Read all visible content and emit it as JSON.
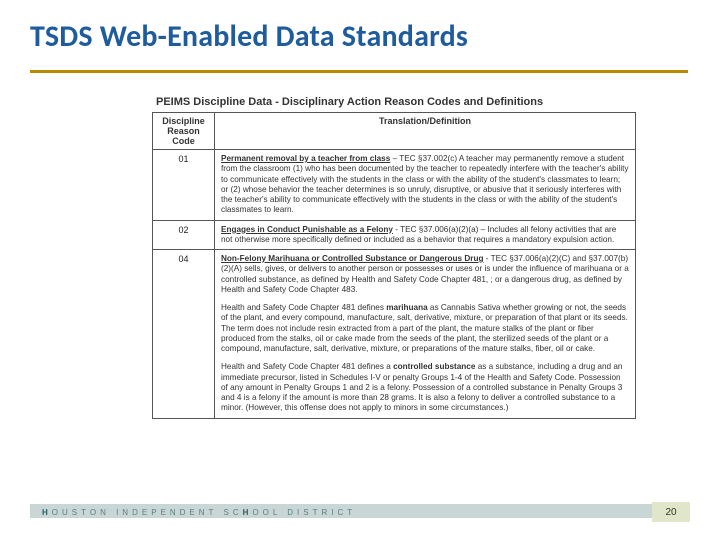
{
  "title": "TSDS Web-Enabled Data Standards",
  "panel_title": "PEIMS Discipline Data - Disciplinary Action Reason Codes and Definitions",
  "header_code": "Discipline Reason Code",
  "header_def": "Translation/Definition",
  "footer_letters": "HOUSTON INDEPENDENT SCHOOL DISTRICT",
  "page_number": "20",
  "rows": [
    {
      "code": "01",
      "lead": "Permanent removal by a teacher from class",
      "body": " – TEC §37.002(c) A teacher may permanently remove a student from the classroom (1) who has been documented by the teacher to repeatedly interfere with the teacher's ability to communicate effectively with the students in the class or with the ability of the student's classmates to learn; or (2) whose behavior the teacher determines is so unruly, disruptive, or abusive that it seriously interferes with the teacher's ability to communicate effectively with the students in the class or with the ability of the student's classmates to learn."
    },
    {
      "code": "02",
      "lead": "Engages in Conduct Punishable as a Felony",
      "body": " - TEC §37.006(a)(2)(a) – Includes all felony activities that are not otherwise more specifically defined or included as a behavior that requires a mandatory expulsion action."
    },
    {
      "code": "04",
      "lead": "Non-Felony Marihuana or Controlled Substance or Dangerous Drug",
      "body": " - TEC §37.006(a)(2)(C) and §37.007(b)(2)(A) sells, gives, or delivers to another person or possesses or uses or is under the influence of marihuana or a controlled substance, as defined by Health and Safety Code Chapter 481, ; or a dangerous drug, as defined by Health and Safety Code Chapter 483.",
      "para1_pre": "Health and Safety Code Chapter 481 defines ",
      "para1_bold": "marihuana",
      "para1_post": " as Cannabis Sativa whether growing or not, the seeds of the plant, and every compound, manufacture, salt, derivative, mixture, or preparation of that plant or its seeds. The term does not include resin extracted from a part of the plant, the mature stalks of the plant or fiber produced from the stalks, oil or cake made from the seeds of the plant, the sterilized seeds of the plant or a compound, manufacture, salt, derivative, mixture, or preparations of the mature stalks, fiber, oil or cake.",
      "para2_pre": "Health and Safety Code Chapter 481 defines a ",
      "para2_bold": "controlled substance",
      "para2_post": " as a substance, including a drug and an immediate precursor, listed in Schedules I-V or penalty Groups 1-4 of the Health and Safety Code. Possession of any amount in Penalty Groups 1 and 2 is a felony. Possession of a controlled substance in Penalty Groups 3 and 4 is a felony if the amount is more than 28 grams. It is also a felony to deliver a controlled substance to a minor. (However, this offense does not apply to minors in some circumstances.)"
    }
  ]
}
